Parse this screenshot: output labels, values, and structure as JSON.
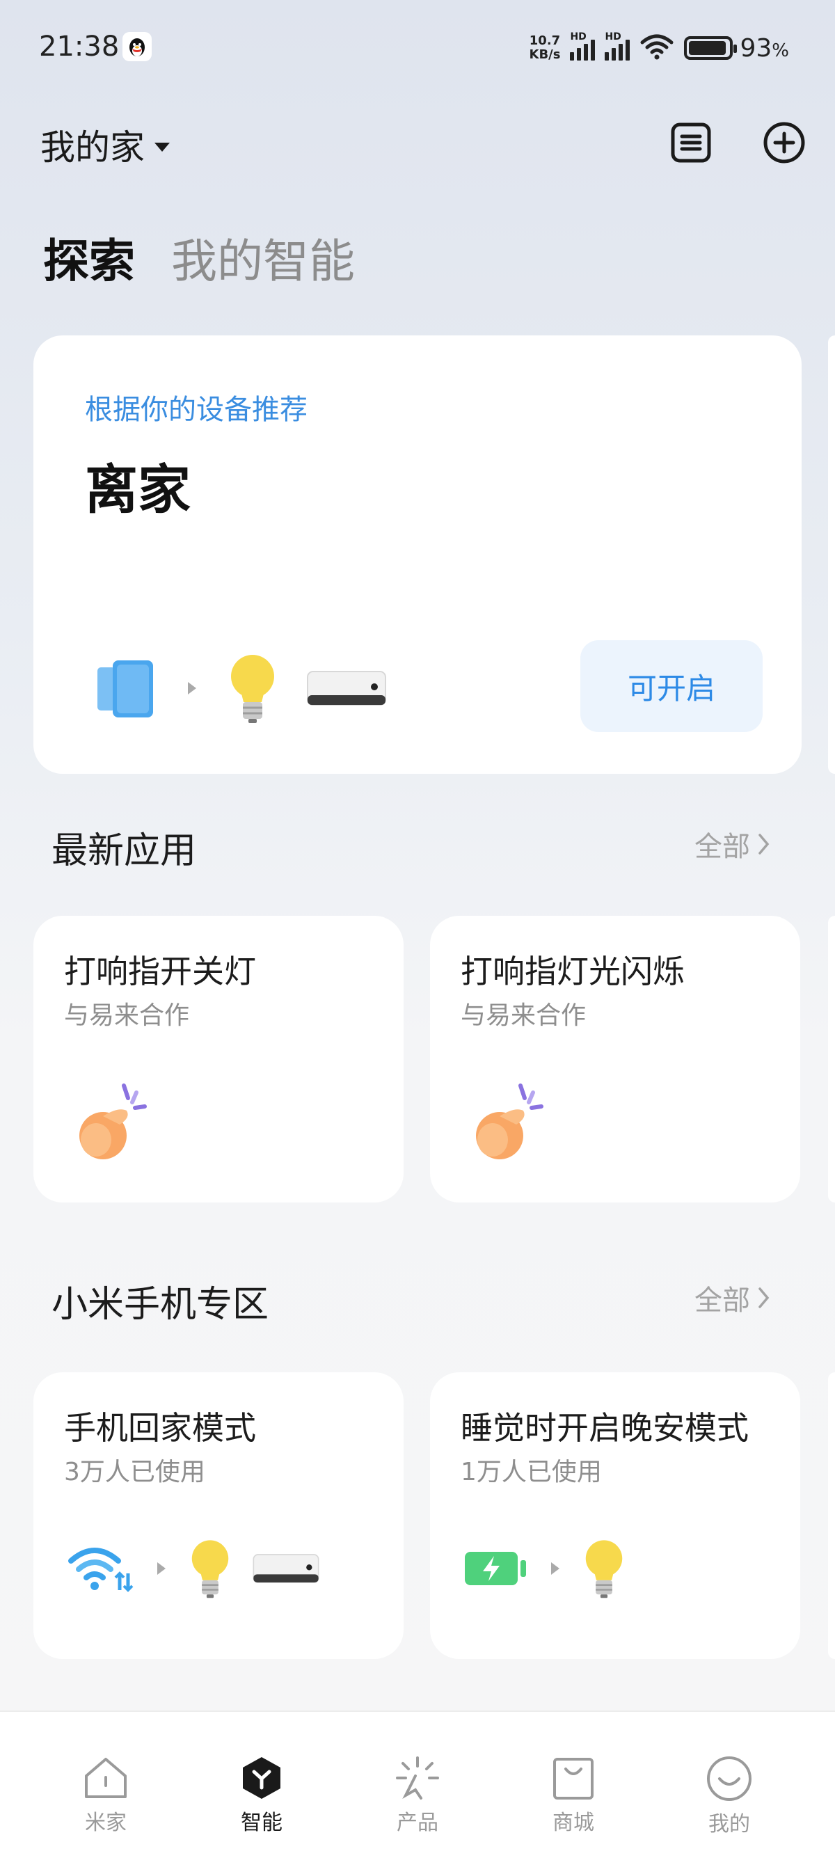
{
  "status_bar": {
    "time": "21:38",
    "net_speed_top": "10.7",
    "net_speed_bottom": "KB/s",
    "signal_label": "HD",
    "battery_percent": "93",
    "battery_suffix": "%",
    "battery_level": 0.93
  },
  "header": {
    "home_name": "我的家"
  },
  "tabs": [
    {
      "label": "探索",
      "active": true
    },
    {
      "label": "我的智能",
      "active": false
    }
  ],
  "recommend_card": {
    "subtitle": "根据你的设备推荐",
    "title": "离家",
    "button_label": "可开启",
    "devices": [
      "door-sensor-icon",
      "bulb-icon",
      "gateway-icon"
    ]
  },
  "latest_apps": {
    "title": "最新应用",
    "more_label": "全部",
    "items": [
      {
        "title": "打响指开关灯",
        "subtitle": "与易来合作",
        "icon": "finger-snap-icon"
      },
      {
        "title": "打响指灯光闪烁",
        "subtitle": "与易来合作",
        "icon": "finger-snap-icon"
      }
    ]
  },
  "xiaomi_zone": {
    "title": "小米手机专区",
    "more_label": "全部",
    "items": [
      {
        "title": "手机回家模式",
        "subtitle": "3万人已使用",
        "icons": [
          "wifi-icon",
          "bulb-icon",
          "gateway-icon"
        ]
      },
      {
        "title": "睡觉时开启晚安模式",
        "subtitle": "1万人已使用",
        "icons": [
          "charging-battery-icon",
          "bulb-icon"
        ]
      }
    ]
  },
  "bottom_nav": [
    {
      "label": "米家",
      "icon": "home-icon",
      "active": false
    },
    {
      "label": "智能",
      "icon": "smart-icon",
      "active": true
    },
    {
      "label": "产品",
      "icon": "product-icon",
      "active": false
    },
    {
      "label": "商城",
      "icon": "shop-bag-icon",
      "active": false
    },
    {
      "label": "我的",
      "icon": "profile-smile-icon",
      "active": false
    }
  ],
  "colors": {
    "accent_blue": "#2d8ae6",
    "bulb_yellow": "#f7d94c",
    "battery_green": "#4fd17c"
  }
}
